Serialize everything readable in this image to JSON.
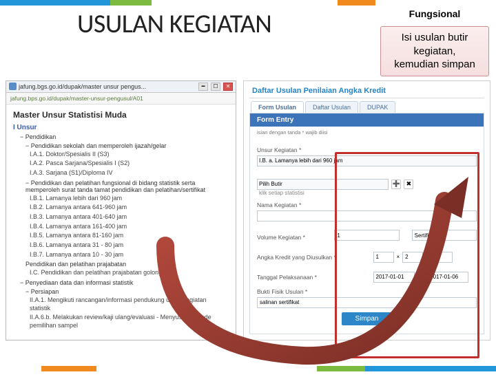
{
  "header": {
    "title": "USULAN KEGIATAN",
    "fungsional": "Fungsional",
    "callout": "Isi usulan butir kegiatan, kemudian simpan"
  },
  "leftPanel": {
    "tabTitle": "jafung.bgs.go.id/dupak/master unsur pengus...",
    "url": "jafung.bps.go.id/dupak/master-unsur-pengusul/A01",
    "masterTitle": "Master Unsur Statistisi Muda",
    "sectionUnsur": "I Unsur",
    "groupPendidikan": "− Pendidikan",
    "subPendidikanSekolah": "− Pendidikan sekolah dan memperoleh ijazah/gelar",
    "items1": [
      "I.A.1. Doktor/Spesialis II (S3)",
      "I.A.2. Pasca Sarjana/Spesialis I (S2)",
      "I.A.3. Sarjana (S1)/Diploma IV"
    ],
    "subPelatihan": "− Pendidikan dan pelatihan fungsional di bidang statistik serta memperoleh surat tanda tamat pendidikan dan pelatihan/sertifikat",
    "items2": [
      "I.B.1. Lamanya lebih dari 960 jam",
      "I.B.2. Lamanya antara 641-960 jam",
      "I.B.3. Lamanya antara 401-640 jam",
      "I.B.4. Lamanya antara 161-400 jam",
      "I.B.5. Lamanya antara 81-160 jam",
      "I.B.6. Lamanya antara 31 - 80 jam",
      "I.B.7. Lamanya antara 10 - 30 jam"
    ],
    "subPrajab": "Pendidikan dan pelatihan prajabatan",
    "itemPrajab": "I.C. Pendidikan dan pelatihan prajabatan golongan III",
    "groupPenyediaan": "− Penyediaan data dan informasi statistik",
    "subPersiapan": "− Persiapan",
    "itemsPersiapan": [
      "II.A.1. Mengikuti rancangan/informasi pendukung untuk kegiatan statistik",
      "II.A.6.b. Melakukan review/kaji ulang/evaluasi - Menyusun metode pemilihan sampel"
    ]
  },
  "rightPanel": {
    "daftarTitle": "Daftar Usulan Penilaian Angka Kredit",
    "tabs": [
      "Form Usulan",
      "Daftar Usulan",
      "DUPAK"
    ],
    "formTitle": "Form Entry",
    "note": "isian dengan tanda * wajib diisi",
    "fields": {
      "unsurKegiatan": {
        "label": "Unsur Kegiatan *",
        "value": "I.B. a. Lamanya lebih dari 960 jam"
      },
      "pilihButir": {
        "label": "Pilih Butir",
        "hint": "klik setiap statistisi"
      },
      "namaKegiatan": {
        "label": "Nama Kegiatan *",
        "value": ""
      },
      "volume": {
        "label": "Volume Kegiatan *",
        "val1": "1",
        "val2": "Sertifikat"
      },
      "angkaKredit": {
        "label": "Angka Kredit yang Diusulkan *",
        "v1": "1",
        "v2": "2",
        "v3": "2"
      },
      "tanggal": {
        "label": "Tanggal Pelaksanaan *",
        "from": "2017-01-01",
        "sd": "s.d",
        "to": "2017-01-06"
      },
      "bukti": {
        "label": "Bukti Fisik Usulan *",
        "value": "salinan sertifikat"
      }
    },
    "save": "Simpan"
  }
}
